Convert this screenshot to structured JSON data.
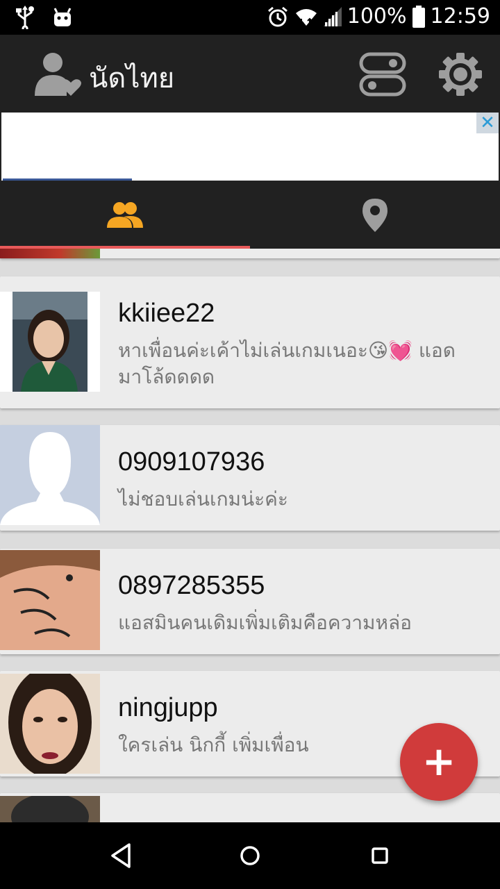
{
  "status_bar": {
    "battery": "100%",
    "time": "12:59",
    "icons": [
      "usb-icon",
      "android-icon",
      "alarm-icon",
      "wifi-icon",
      "signal-icon",
      "battery-icon"
    ]
  },
  "app_bar": {
    "title": "นัดไทย",
    "icons": [
      "user-heart-icon",
      "toggle-icon",
      "gear-icon"
    ]
  },
  "ad": {
    "close": "✕"
  },
  "tabs": [
    {
      "icon": "people-icon",
      "active": true,
      "color": "#f5a623"
    },
    {
      "icon": "location-pin-icon",
      "active": false,
      "color": "#9e9e9e"
    }
  ],
  "contacts": [
    {
      "name": "kkiiee22",
      "message": "หาเพื่อนค่ะเค้าไม่เล่นเกมเนอะ😘💓 แอดมาโล้ดดดด"
    },
    {
      "name": "0909107936",
      "message": "ไม่ชอบเล่นเกมน่ะค่ะ"
    },
    {
      "name": "0897285355",
      "message": "แอสมินคนเดิมเพิ่มเติมคือความหล่อ"
    },
    {
      "name": "ningjupp",
      "message": "ใครเล่น นิกกี้ เพิ่มเพื่อน"
    }
  ],
  "fab": {
    "label": "+"
  },
  "colors": {
    "accent": "#d03b3b",
    "tab_indicator": "#e85a5a",
    "appbar": "#212121"
  }
}
